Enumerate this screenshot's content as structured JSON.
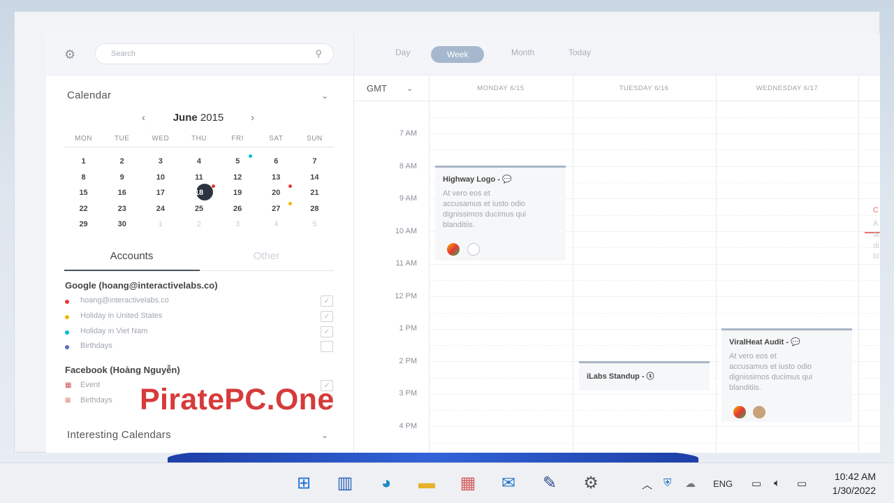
{
  "sidebar": {
    "search_placeholder": "Search",
    "calendar_title": "Calendar",
    "month_name": "June",
    "year": "2015",
    "prev_glyph": "‹",
    "next_glyph": "›",
    "weekdays": [
      "MON",
      "TUE",
      "WED",
      "THU",
      "FRI",
      "SAT",
      "SUN"
    ],
    "weeks": [
      [
        "1",
        "2",
        "3",
        "4",
        "5",
        "6",
        "7"
      ],
      [
        "8",
        "9",
        "10",
        "11",
        "12",
        "13",
        "14"
      ],
      [
        "15",
        "16",
        "17",
        "18",
        "19",
        "20",
        "21"
      ],
      [
        "22",
        "23",
        "24",
        "25",
        "26",
        "27",
        "28"
      ],
      [
        "29",
        "30",
        "1",
        "2",
        "3",
        "4",
        "5"
      ]
    ],
    "tabs": {
      "accounts": "Accounts",
      "other": "Other"
    },
    "google": {
      "title": "Google (hoang@interactivelabs.co)",
      "items": [
        {
          "label": "hoang@interactivelabs.co",
          "color": "#e53935",
          "checked": true
        },
        {
          "label": "Holiday in United States",
          "color": "#f4b400",
          "checked": true
        },
        {
          "label": "Holiday in Viet Nam",
          "color": "#00bcd4",
          "checked": true
        },
        {
          "label": "Birthdays",
          "color": "#5c6bc0",
          "checked": false
        }
      ]
    },
    "facebook": {
      "title": "Facebook (Hoàng Nguyễn)",
      "items": [
        {
          "label": "Event",
          "icon": "calendar-31-icon",
          "checked": true
        },
        {
          "label": "Birthdays",
          "icon": "gift-icon",
          "checked": false
        }
      ]
    },
    "interesting_title": "Interesting Calendars"
  },
  "main": {
    "views": [
      "Day",
      "Week",
      "Month",
      "Today"
    ],
    "active_view": "Week",
    "timezone": "GMT",
    "days": [
      "MONDAY 6/15",
      "TUESDAY 6/16",
      "WEDNESDAY 6/17"
    ],
    "times": [
      "7 AM",
      "8 AM",
      "9 AM",
      "10 AM",
      "11 AM",
      "12 PM",
      "1 PM",
      "2 PM",
      "3 PM",
      "4 PM"
    ],
    "events": {
      "highway": {
        "title": "Highway Logo  -  💬",
        "desc": [
          "At vero eos et",
          "accusamus et iusto odio",
          "dignissimos ducimus qui",
          "blanditiis."
        ]
      },
      "standup": {
        "title": "iLabs Standup  -  ⓢ"
      },
      "viralheat": {
        "title": "ViralHeat Audit  -  💬",
        "desc": [
          "At vero eos et",
          "accusamus et iusto odio",
          "dignissimos ducimus qui",
          "blanditiis."
        ]
      }
    },
    "edge_text": [
      "C",
      "A",
      "ac",
      "di",
      "bl"
    ]
  },
  "watermark": "PiratePC.One",
  "taskbar": {
    "lang": "ENG",
    "time": "10:42 AM",
    "date": "1/30/2022"
  }
}
